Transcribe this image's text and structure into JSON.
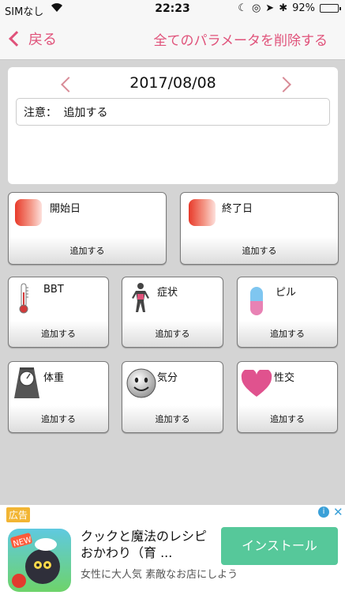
{
  "status_bar": {
    "carrier": "SIMなし",
    "time": "22:23",
    "battery": "92%",
    "battery_level": 0.92
  },
  "nav": {
    "back_label": "戻る",
    "delete_all_label": "全てのパラメータを削除する"
  },
  "date_card": {
    "date": "2017/08/08",
    "note_label": "注意：",
    "note_placeholder": "追加する"
  },
  "tiles": [
    {
      "title": "開始日",
      "add": "追加する",
      "icon": "period-start-swatch"
    },
    {
      "title": "終了日",
      "add": "追加する",
      "icon": "period-end-swatch"
    },
    {
      "title": "BBT",
      "add": "追加する",
      "icon": "thermometer-icon"
    },
    {
      "title": "症状",
      "add": "追加する",
      "icon": "body-icon"
    },
    {
      "title": "ピル",
      "add": "追加する",
      "icon": "pill-icon"
    },
    {
      "title": "体重",
      "add": "追加する",
      "icon": "scale-icon"
    },
    {
      "title": "気分",
      "add": "追加する",
      "icon": "smiley-icon"
    },
    {
      "title": "性交",
      "add": "追加する",
      "icon": "heart-icon"
    }
  ],
  "ad": {
    "label": "広告",
    "badge_text": "NEW",
    "title": "クックと魔法のレシピ おかわり（育 ...",
    "description": "女性に大人気 素敵なお店にしよう",
    "install_label": "インストール"
  },
  "colors": {
    "accent": "#e0527a",
    "install_button": "#56c89a",
    "background": "#d4d4d4"
  }
}
